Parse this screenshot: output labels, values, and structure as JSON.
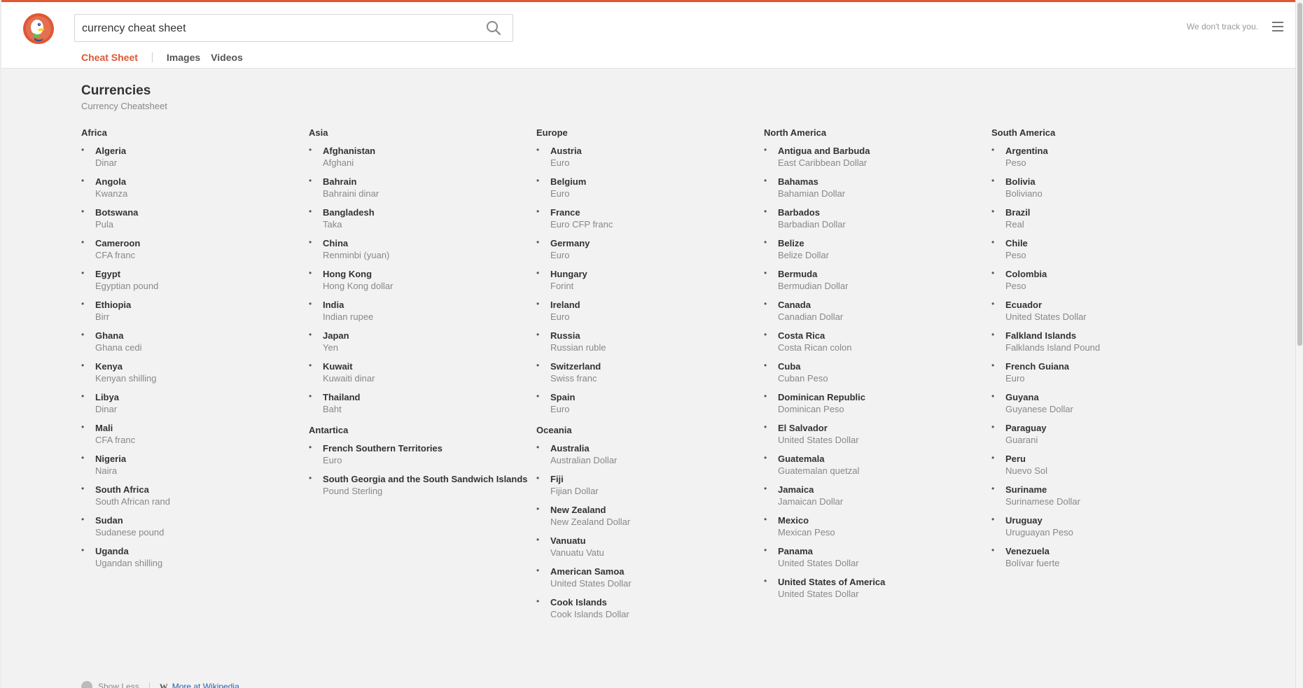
{
  "header": {
    "search_value": "currency cheat sheet",
    "tagline": "We don't track you.",
    "accent_color": "#de5833"
  },
  "tabs": [
    {
      "label": "Cheat Sheet",
      "active": true
    },
    {
      "label": "Images",
      "active": false
    },
    {
      "label": "Videos",
      "active": false
    }
  ],
  "main": {
    "title": "Currencies",
    "subtitle": "Currency Cheatsheet",
    "columns": [
      [
        {
          "region": "Africa",
          "items": [
            {
              "country": "Algeria",
              "currency": "Dinar"
            },
            {
              "country": "Angola",
              "currency": "Kwanza"
            },
            {
              "country": "Botswana",
              "currency": "Pula"
            },
            {
              "country": "Cameroon",
              "currency": "CFA franc"
            },
            {
              "country": "Egypt",
              "currency": "Egyptian pound"
            },
            {
              "country": "Ethiopia",
              "currency": "Birr"
            },
            {
              "country": "Ghana",
              "currency": "Ghana cedi"
            },
            {
              "country": "Kenya",
              "currency": "Kenyan shilling"
            },
            {
              "country": "Libya",
              "currency": "Dinar"
            },
            {
              "country": "Mali",
              "currency": "CFA franc"
            },
            {
              "country": "Nigeria",
              "currency": "Naira"
            },
            {
              "country": "South Africa",
              "currency": "South African rand"
            },
            {
              "country": "Sudan",
              "currency": "Sudanese pound"
            },
            {
              "country": "Uganda",
              "currency": "Ugandan shilling"
            }
          ]
        }
      ],
      [
        {
          "region": "Asia",
          "items": [
            {
              "country": "Afghanistan",
              "currency": "Afghani"
            },
            {
              "country": "Bahrain",
              "currency": "Bahraini dinar"
            },
            {
              "country": "Bangladesh",
              "currency": "Taka"
            },
            {
              "country": "China",
              "currency": "Renminbi (yuan)"
            },
            {
              "country": "Hong Kong",
              "currency": "Hong Kong dollar"
            },
            {
              "country": "India",
              "currency": "Indian rupee"
            },
            {
              "country": "Japan",
              "currency": "Yen"
            },
            {
              "country": "Kuwait",
              "currency": "Kuwaiti dinar"
            },
            {
              "country": "Thailand",
              "currency": "Baht"
            }
          ]
        },
        {
          "region": "Antartica",
          "items": [
            {
              "country": "French Southern Territories",
              "currency": "Euro"
            },
            {
              "country": "South Georgia and the South Sandwich Islands",
              "currency": "Pound Sterling"
            }
          ]
        }
      ],
      [
        {
          "region": "Europe",
          "items": [
            {
              "country": "Austria",
              "currency": "Euro"
            },
            {
              "country": "Belgium",
              "currency": "Euro"
            },
            {
              "country": "France",
              "currency": "Euro CFP franc"
            },
            {
              "country": "Germany",
              "currency": "Euro"
            },
            {
              "country": "Hungary",
              "currency": "Forint"
            },
            {
              "country": "Ireland",
              "currency": "Euro"
            },
            {
              "country": "Russia",
              "currency": "Russian ruble"
            },
            {
              "country": "Switzerland",
              "currency": "Swiss franc"
            },
            {
              "country": "Spain",
              "currency": "Euro"
            }
          ]
        },
        {
          "region": "Oceania",
          "items": [
            {
              "country": "Australia",
              "currency": "Australian Dollar"
            },
            {
              "country": "Fiji",
              "currency": "Fijian Dollar"
            },
            {
              "country": "New Zealand",
              "currency": "New Zealand Dollar"
            },
            {
              "country": "Vanuatu",
              "currency": "Vanuatu Vatu"
            },
            {
              "country": "American Samoa",
              "currency": "United States Dollar"
            },
            {
              "country": "Cook Islands",
              "currency": "Cook Islands Dollar"
            }
          ]
        }
      ],
      [
        {
          "region": "North America",
          "items": [
            {
              "country": "Antigua and Barbuda",
              "currency": "East Caribbean Dollar"
            },
            {
              "country": "Bahamas",
              "currency": "Bahamian Dollar"
            },
            {
              "country": "Barbados",
              "currency": "Barbadian Dollar"
            },
            {
              "country": "Belize",
              "currency": "Belize Dollar"
            },
            {
              "country": "Bermuda",
              "currency": "Bermudian Dollar"
            },
            {
              "country": "Canada",
              "currency": "Canadian Dollar"
            },
            {
              "country": "Costa Rica",
              "currency": "Costa Rican colon"
            },
            {
              "country": "Cuba",
              "currency": "Cuban Peso"
            },
            {
              "country": "Dominican Republic",
              "currency": "Dominican Peso"
            },
            {
              "country": "El Salvador",
              "currency": "United States Dollar"
            },
            {
              "country": "Guatemala",
              "currency": "Guatemalan quetzal"
            },
            {
              "country": "Jamaica",
              "currency": "Jamaican Dollar"
            },
            {
              "country": "Mexico",
              "currency": "Mexican Peso"
            },
            {
              "country": "Panama",
              "currency": "United States Dollar"
            },
            {
              "country": "United States of America",
              "currency": "United States Dollar"
            }
          ]
        }
      ],
      [
        {
          "region": "South America",
          "items": [
            {
              "country": "Argentina",
              "currency": "Peso"
            },
            {
              "country": "Bolivia",
              "currency": "Boliviano"
            },
            {
              "country": "Brazil",
              "currency": "Real"
            },
            {
              "country": "Chile",
              "currency": "Peso"
            },
            {
              "country": "Colombia",
              "currency": "Peso"
            },
            {
              "country": "Ecuador",
              "currency": "United States Dollar"
            },
            {
              "country": "Falkland Islands",
              "currency": "Falklands Island Pound"
            },
            {
              "country": "French Guiana",
              "currency": "Euro"
            },
            {
              "country": "Guyana",
              "currency": "Guyanese Dollar"
            },
            {
              "country": "Paraguay",
              "currency": "Guarani"
            },
            {
              "country": "Peru",
              "currency": "Nuevo Sol"
            },
            {
              "country": "Suriname",
              "currency": "Surinamese Dollar"
            },
            {
              "country": "Uruguay",
              "currency": "Uruguayan Peso"
            },
            {
              "country": "Venezuela",
              "currency": "Bolívar fuerte"
            }
          ]
        }
      ]
    ]
  },
  "footer": {
    "show_less_label": "Show Less",
    "wiki_glyph": "W",
    "wiki_label": "More at Wikipedia"
  }
}
